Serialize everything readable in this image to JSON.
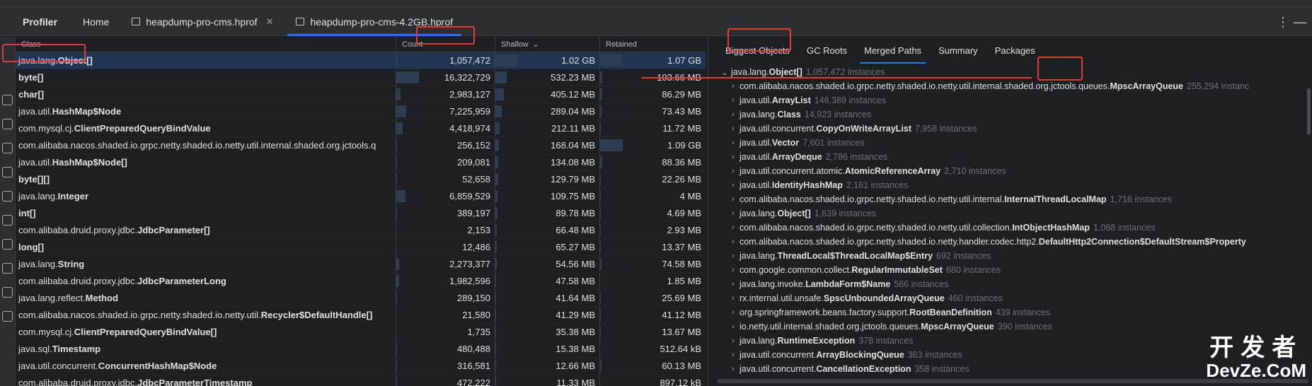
{
  "tabs": {
    "title": "Profiler",
    "home": "Home",
    "file1": "heapdump-pro-cms.hprof",
    "file2": "heapdump-pro-cms-4.2GB.hprof",
    "close": "✕"
  },
  "toolbar": {
    "kebab": "⋮",
    "minimize": "—"
  },
  "table": {
    "headers": {
      "class": "Class",
      "count": "Count",
      "shallow": "Shallow",
      "shallow_sort": "⌄",
      "retained": "Retained"
    },
    "rows": [
      {
        "pfx": "java.lang.",
        "nm": "Object[]",
        "count": "1,057,472",
        "shallow": "1.02 GB",
        "retained": "1.07 GB",
        "cf": 0.065,
        "sf": 1.0,
        "rf": 0.98
      },
      {
        "pfx": "",
        "nm": "byte[]",
        "count": "16,322,729",
        "shallow": "532.23 MB",
        "retained": "103.66 MB",
        "cf": 1.0,
        "sf": 0.51,
        "rf": 0.09
      },
      {
        "pfx": "",
        "nm": "char[]",
        "count": "2,983,127",
        "shallow": "405.12 MB",
        "retained": "86.29 MB",
        "cf": 0.18,
        "sf": 0.39,
        "rf": 0.08
      },
      {
        "pfx": "java.util.",
        "nm": "HashMap$Node",
        "count": "7,225,959",
        "shallow": "289.04 MB",
        "retained": "73.43 MB",
        "cf": 0.44,
        "sf": 0.28,
        "rf": 0.07
      },
      {
        "pfx": "com.mysql.cj.",
        "nm": "ClientPreparedQueryBindValue",
        "count": "4,418,974",
        "shallow": "212.11 MB",
        "retained": "11.72 MB",
        "cf": 0.27,
        "sf": 0.2,
        "rf": 0.01
      },
      {
        "pfx": "com.alibaba.nacos.shaded.io.grpc.netty.shaded.io.netty.util.internal.shaded.org.jctools.q",
        "nm": "",
        "count": "256,152",
        "shallow": "168.04 MB",
        "retained": "1.09 GB",
        "cf": 0.016,
        "sf": 0.16,
        "rf": 1.0
      },
      {
        "pfx": "java.util.",
        "nm": "HashMap$Node[]",
        "count": "209,081",
        "shallow": "134.08 MB",
        "retained": "88.36 MB",
        "cf": 0.013,
        "sf": 0.13,
        "rf": 0.08
      },
      {
        "pfx": "",
        "nm": "byte[][]",
        "count": "52,658",
        "shallow": "129.79 MB",
        "retained": "22.26 MB",
        "cf": 0.003,
        "sf": 0.12,
        "rf": 0.02
      },
      {
        "pfx": "java.lang.",
        "nm": "Integer",
        "count": "6,859,529",
        "shallow": "109.75 MB",
        "retained": "4 MB",
        "cf": 0.42,
        "sf": 0.1,
        "rf": 0.004
      },
      {
        "pfx": "",
        "nm": "int[]",
        "count": "389,197",
        "shallow": "89.78 MB",
        "retained": "4.69 MB",
        "cf": 0.024,
        "sf": 0.09,
        "rf": 0.004
      },
      {
        "pfx": "com.alibaba.druid.proxy.jdbc.",
        "nm": "JdbcParameter[]",
        "count": "2,153",
        "shallow": "66.48 MB",
        "retained": "2.93 MB",
        "cf": 0.0,
        "sf": 0.06,
        "rf": 0.003
      },
      {
        "pfx": "",
        "nm": "long[]",
        "count": "12,486",
        "shallow": "65.27 MB",
        "retained": "13.37 MB",
        "cf": 0.001,
        "sf": 0.06,
        "rf": 0.012
      },
      {
        "pfx": "java.lang.",
        "nm": "String",
        "count": "2,273,377",
        "shallow": "54.56 MB",
        "retained": "74.58 MB",
        "cf": 0.14,
        "sf": 0.05,
        "rf": 0.07
      },
      {
        "pfx": "com.alibaba.druid.proxy.jdbc.",
        "nm": "JdbcParameterLong",
        "count": "1,982,596",
        "shallow": "47.58 MB",
        "retained": "1.85 MB",
        "cf": 0.12,
        "sf": 0.045,
        "rf": 0.002
      },
      {
        "pfx": "java.lang.reflect.",
        "nm": "Method",
        "count": "289,150",
        "shallow": "41.64 MB",
        "retained": "25.69 MB",
        "cf": 0.018,
        "sf": 0.04,
        "rf": 0.023
      },
      {
        "pfx": "com.alibaba.nacos.shaded.io.grpc.netty.shaded.io.netty.util.",
        "nm": "Recycler$DefaultHandle[]",
        "count": "21,580",
        "shallow": "41.29 MB",
        "retained": "41.12 MB",
        "cf": 0.001,
        "sf": 0.04,
        "rf": 0.037
      },
      {
        "pfx": "com.mysql.cj.",
        "nm": "ClientPreparedQueryBindValue[]",
        "count": "1,735",
        "shallow": "35.38 MB",
        "retained": "13.67 MB",
        "cf": 0.0,
        "sf": 0.034,
        "rf": 0.012
      },
      {
        "pfx": "java.sql.",
        "nm": "Timestamp",
        "count": "480,488",
        "shallow": "15.38 MB",
        "retained": "512.64 kB",
        "cf": 0.03,
        "sf": 0.015,
        "rf": 0.0
      },
      {
        "pfx": "java.util.concurrent.",
        "nm": "ConcurrentHashMap$Node",
        "count": "316,581",
        "shallow": "12.66 MB",
        "retained": "60.13 MB",
        "cf": 0.02,
        "sf": 0.012,
        "rf": 0.054
      },
      {
        "pfx": "com.alibaba.druid.proxy.jdbc.",
        "nm": "JdbcParameterTimestamp",
        "count": "472,222",
        "shallow": "11.33 MB",
        "retained": "897.12 kB",
        "cf": 0.03,
        "sf": 0.011,
        "rf": 0.001
      }
    ]
  },
  "right_tabs": [
    "Biggest Objects",
    "GC Roots",
    "Merged Paths",
    "Summary",
    "Packages"
  ],
  "tree": {
    "root": {
      "pfx": "java.lang.",
      "nm": "Object[]",
      "cnt": "1,057,472 instances",
      "chev": "⌄"
    },
    "items": [
      {
        "pfx": "com.alibaba.nacos.shaded.io.grpc.netty.shaded.io.netty.util.internal.shaded.org.jctools.queues.",
        "nm": "MpscArrayQueue",
        "cnt": "255,294 instanc"
      },
      {
        "pfx": "java.util.",
        "nm": "ArrayList",
        "cnt": "146,389 instances"
      },
      {
        "pfx": "java.lang.",
        "nm": "Class",
        "cnt": "14,923 instances"
      },
      {
        "pfx": "java.util.concurrent.",
        "nm": "CopyOnWriteArrayList",
        "cnt": "7,958 instances"
      },
      {
        "pfx": "java.util.",
        "nm": "Vector",
        "cnt": "7,601 instances"
      },
      {
        "pfx": "java.util.",
        "nm": "ArrayDeque",
        "cnt": "2,786 instances"
      },
      {
        "pfx": "java.util.concurrent.atomic.",
        "nm": "AtomicReferenceArray",
        "cnt": "2,710 instances"
      },
      {
        "pfx": "java.util.",
        "nm": "IdentityHashMap",
        "cnt": "2,161 instances"
      },
      {
        "pfx": "com.alibaba.nacos.shaded.io.grpc.netty.shaded.io.netty.util.internal.",
        "nm": "InternalThreadLocalMap",
        "cnt": "1,716 instances"
      },
      {
        "pfx": "java.lang.",
        "nm": "Object[]",
        "cnt": "1,639 instances"
      },
      {
        "pfx": "com.alibaba.nacos.shaded.io.grpc.netty.shaded.io.netty.util.collection.",
        "nm": "IntObjectHashMap",
        "cnt": "1,068 instances"
      },
      {
        "pfx": "com.alibaba.nacos.shaded.io.grpc.netty.shaded.io.netty.handler.codec.http2.",
        "nm": "DefaultHttp2Connection$DefaultStream$Property",
        "cnt": ""
      },
      {
        "pfx": "java.lang.",
        "nm": "ThreadLocal$ThreadLocalMap$Entry",
        "cnt": "692 instances"
      },
      {
        "pfx": "com.google.common.collect.",
        "nm": "RegularImmutableSet",
        "cnt": "680 instances"
      },
      {
        "pfx": "java.lang.invoke.",
        "nm": "LambdaForm$Name",
        "cnt": "566 instances"
      },
      {
        "pfx": "rx.internal.util.unsafe.",
        "nm": "SpscUnboundedArrayQueue",
        "cnt": "460 instances"
      },
      {
        "pfx": "org.springframework.beans.factory.support.",
        "nm": "RootBeanDefinition",
        "cnt": "439 instances"
      },
      {
        "pfx": "io.netty.util.internal.shaded.org.jctools.queues.",
        "nm": "MpscArrayQueue",
        "cnt": "390 instances"
      },
      {
        "pfx": "java.lang.",
        "nm": "RuntimeException",
        "cnt": "378 instances"
      },
      {
        "pfx": "java.util.concurrent.",
        "nm": "ArrayBlockingQueue",
        "cnt": "363 instances"
      },
      {
        "pfx": "java.util.concurrent.",
        "nm": "CancellationException",
        "cnt": "358 instances"
      }
    ],
    "child_chev": "›"
  },
  "watermark": {
    "line1": "开发者",
    "line2": "DevZe.CoM"
  },
  "colors": {
    "accent": "#3574f0",
    "highlight": "#e33a3a",
    "selection": "#1f3552",
    "bar": "#2f3d52"
  }
}
